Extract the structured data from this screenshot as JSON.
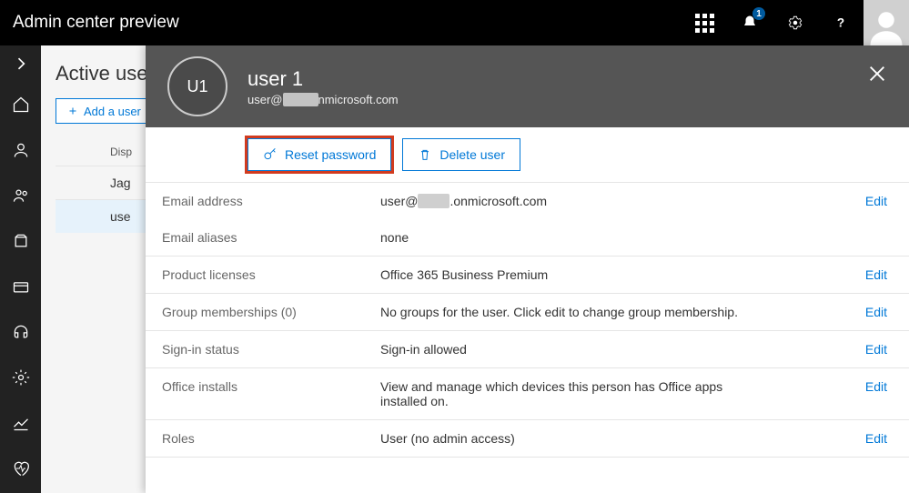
{
  "header": {
    "title": "Admin center preview",
    "notification_count": "1"
  },
  "page": {
    "title": "Active users",
    "add_user_label": "Add a user",
    "column_label": "Disp",
    "rows": [
      "Jag",
      "use"
    ]
  },
  "panel": {
    "avatar_initials": "U1",
    "user_name": "user 1",
    "user_email_prefix": "user@",
    "user_email_redacted": "xxxxxx",
    "user_email_suffix": "nmicrosoft.com",
    "reset_password_label": "Reset password",
    "delete_user_label": "Delete user",
    "edit_label": "Edit",
    "details": {
      "email_address": {
        "label": "Email address",
        "prefix": "user@",
        "redacted": "xxxxx",
        "suffix": ".onmicrosoft.com"
      },
      "email_aliases": {
        "label": "Email aliases",
        "value": "none"
      },
      "product_licenses": {
        "label": "Product licenses",
        "value": "Office 365 Business Premium"
      },
      "group_memberships": {
        "label": "Group memberships (0)",
        "value": "No groups for the user. Click edit to change group membership."
      },
      "signin_status": {
        "label": "Sign-in status",
        "value": "Sign-in allowed"
      },
      "office_installs": {
        "label": "Office installs",
        "value": "View and manage which devices this person has Office apps installed on."
      },
      "roles": {
        "label": "Roles",
        "value": "User (no admin access)"
      }
    }
  }
}
